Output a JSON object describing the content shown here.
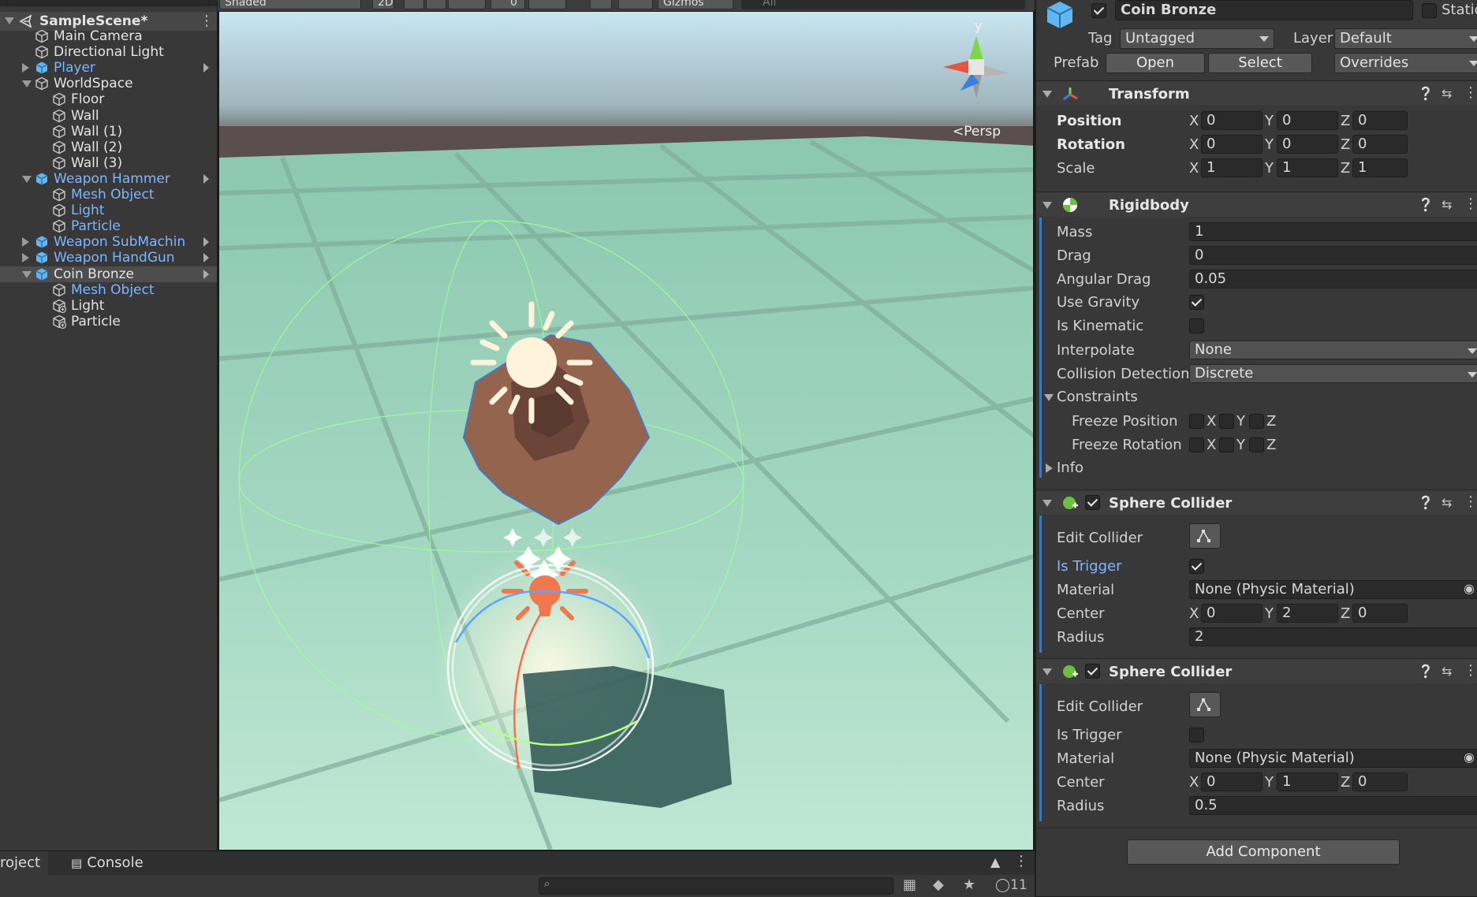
{
  "hierarchy": {
    "search_placeholder": "All",
    "scene_name": "SampleScene*",
    "items": [
      {
        "label": "Main Camera"
      },
      {
        "label": "Directional Light"
      },
      {
        "label": "Player"
      },
      {
        "label": "WorldSpace"
      },
      {
        "label": "Floor"
      },
      {
        "label": "Wall"
      },
      {
        "label": "Wall (1)"
      },
      {
        "label": "Wall (2)"
      },
      {
        "label": "Wall (3)"
      },
      {
        "label": "Weapon Hammer"
      },
      {
        "label": "Mesh Object"
      },
      {
        "label": "Light"
      },
      {
        "label": "Particle"
      },
      {
        "label": "Weapon SubMachin"
      },
      {
        "label": "Weapon HandGun"
      },
      {
        "label": "Coin Bronze"
      },
      {
        "label": "Mesh Object"
      },
      {
        "label": "Light"
      },
      {
        "label": "Particle"
      }
    ]
  },
  "scene_toolbar": {
    "shading_mode": "Shaded",
    "mode_2d": "2D",
    "hidden_count": "0",
    "gizmos_label": "Gizmos",
    "search_placeholder": "All"
  },
  "scene_view": {
    "gizmo_y_label": "y",
    "projection_label": "Persp"
  },
  "inspector": {
    "object_name": "Coin Bronze",
    "static_label": "Static",
    "tag_label": "Tag",
    "tag_value": "Untagged",
    "layer_label": "Layer",
    "layer_value": "Default",
    "prefab_label": "Prefab",
    "open_label": "Open",
    "select_label": "Select",
    "overrides_label": "Overrides",
    "transform": {
      "title": "Transform",
      "position_label": "Position",
      "rotation_label": "Rotation",
      "scale_label": "Scale",
      "position": {
        "x": "0",
        "y": "0",
        "z": "0"
      },
      "rotation": {
        "x": "0",
        "y": "0",
        "z": "0"
      },
      "scale": {
        "x": "1",
        "y": "1",
        "z": "1"
      }
    },
    "rigidbody": {
      "title": "Rigidbody",
      "mass_label": "Mass",
      "mass": "1",
      "drag_label": "Drag",
      "drag": "0",
      "angular_drag_label": "Angular Drag",
      "angular_drag": "0.05",
      "use_gravity_label": "Use Gravity",
      "use_gravity": true,
      "is_kinematic_label": "Is Kinematic",
      "is_kinematic": false,
      "interpolate_label": "Interpolate",
      "interpolate": "None",
      "collision_label": "Collision Detection",
      "collision": "Discrete",
      "constraints_label": "Constraints",
      "freeze_position_label": "Freeze Position",
      "freeze_rotation_label": "Freeze Rotation",
      "info_label": "Info"
    },
    "sphere_collider_1": {
      "title": "Sphere Collider",
      "edit_label": "Edit Collider",
      "trigger_label": "Is Trigger",
      "is_trigger": true,
      "material_label": "Material",
      "material": "None (Physic Material)",
      "center_label": "Center",
      "center": {
        "x": "0",
        "y": "2",
        "z": "0"
      },
      "radius_label": "Radius",
      "radius": "2"
    },
    "sphere_collider_2": {
      "title": "Sphere Collider",
      "edit_label": "Edit Collider",
      "trigger_label": "Is Trigger",
      "is_trigger": false,
      "material_label": "Material",
      "material": "None (Physic Material)",
      "center_label": "Center",
      "center": {
        "x": "0",
        "y": "1",
        "z": "0"
      },
      "radius_label": "Radius",
      "radius": "0.5"
    },
    "add_component_label": "Add Component",
    "axis_x": "X",
    "axis_y": "Y",
    "axis_z": "Z"
  },
  "bottom": {
    "project_tab": "roject",
    "console_tab": "Console",
    "hidden_count": "11"
  }
}
